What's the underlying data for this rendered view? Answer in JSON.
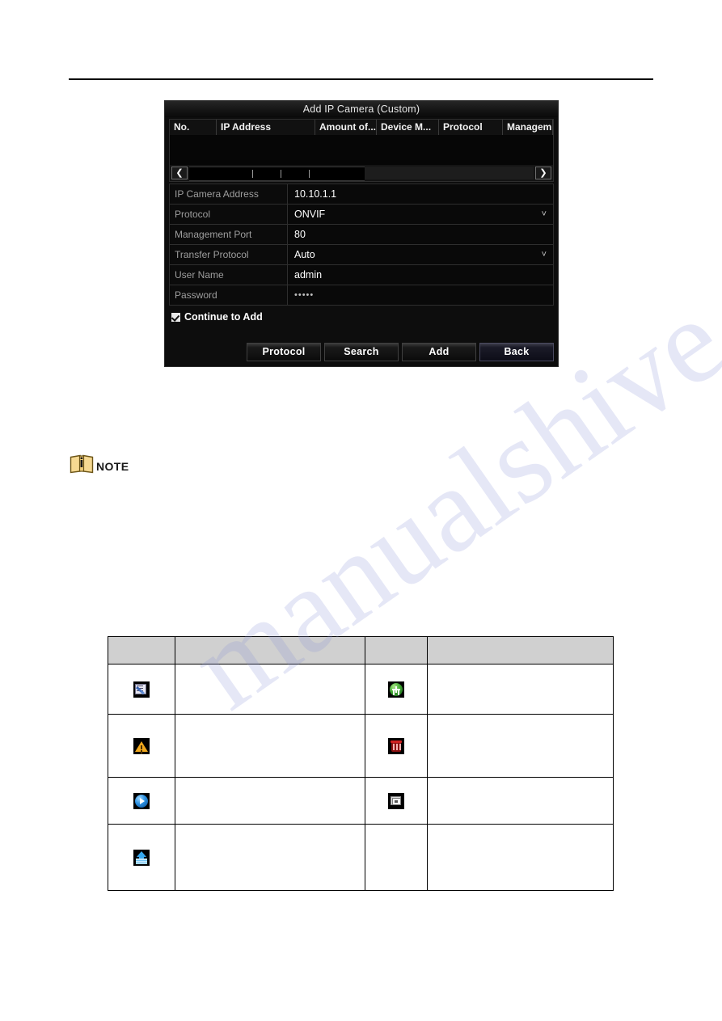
{
  "page": {
    "header_rule": true
  },
  "dialog": {
    "title": "Add IP Camera (Custom)",
    "table": {
      "columns": [
        "No.",
        "IP Address",
        "Amount of...",
        "Device M...",
        "Protocol",
        "Managem"
      ],
      "rows": [],
      "scroll_left_icon": "chevron-left-icon",
      "scroll_right_icon": "chevron-right-icon"
    },
    "fields": [
      {
        "label": "IP Camera Address",
        "value": "10.10.1.1",
        "type": "text"
      },
      {
        "label": "Protocol",
        "value": "ONVIF",
        "type": "select"
      },
      {
        "label": "Management Port",
        "value": "80",
        "type": "text"
      },
      {
        "label": "Transfer Protocol",
        "value": "Auto",
        "type": "select"
      },
      {
        "label": "User Name",
        "value": "admin",
        "type": "text"
      },
      {
        "label": "Password",
        "value": "•••••",
        "type": "password"
      }
    ],
    "checkbox": {
      "label": "Continue to Add",
      "checked": true
    },
    "buttons": [
      {
        "label": "Protocol",
        "focused": false
      },
      {
        "label": "Search",
        "focused": false
      },
      {
        "label": "Add",
        "focused": false
      },
      {
        "label": "Back",
        "focused": true
      }
    ]
  },
  "note": {
    "icon": "note-book-info-icon",
    "label": "NOTE"
  },
  "icon_table": {
    "headers": [
      "",
      "",
      "",
      ""
    ],
    "rows": [
      {
        "icon_left": "edit-document-icon",
        "text_left": "",
        "icon_right": "add-green-plus-icon",
        "text_right": ""
      },
      {
        "icon_left": "warning-triangle-icon",
        "text_left": "",
        "icon_right": "delete-trash-icon",
        "text_right": ""
      },
      {
        "icon_left": "play-live-view-icon",
        "text_left": "",
        "icon_right": "advanced-settings-icon",
        "text_right": ""
      },
      {
        "icon_left": "upgrade-upload-icon",
        "text_left": "",
        "icon_right": "",
        "text_right": ""
      }
    ]
  },
  "colors": {
    "dialog_bg": "#0d0d0d",
    "dialog_text": "#ffffff",
    "label_text": "#9e9e9e",
    "table_header_bg": "#d0d0d0",
    "add_green": "#41a832",
    "delete_red": "#d02020",
    "warn_orange": "#f0a81e",
    "play_blue": "#2a8fe0",
    "note_yellow": "#f2d385"
  }
}
